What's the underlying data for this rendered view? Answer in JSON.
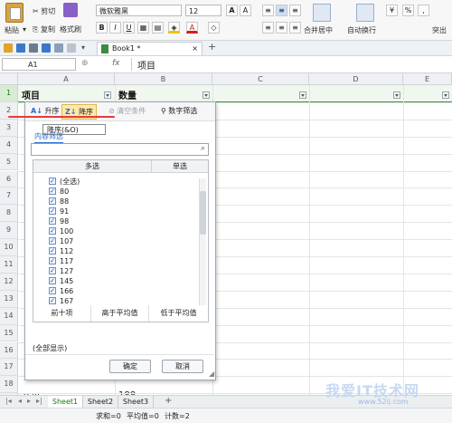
{
  "ribbon": {
    "paste": "粘贴",
    "cut": "剪切",
    "copy": "复制",
    "format_painter": "格式刷",
    "font_name": "微软雅黑",
    "font_size": "12",
    "bold": "B",
    "italic": "I",
    "underline": "U",
    "merge_center": "合并居中",
    "wrap_text": "自动换行",
    "overflow": "突出"
  },
  "quickbar": {
    "book_tab": "Book1 *",
    "new_tab": "+"
  },
  "formula_bar": {
    "name_box": "A1",
    "fx": "fx",
    "content": "项目"
  },
  "grid": {
    "columns": [
      "A",
      "B",
      "C",
      "D",
      "E"
    ],
    "rows": [
      "1",
      "2",
      "3",
      "4",
      "5",
      "6",
      "7",
      "8",
      "9",
      "10",
      "11",
      "12",
      "13",
      "14",
      "15",
      "16",
      "17",
      "18",
      "19"
    ],
    "a1": "项目",
    "b1": "数量",
    "a19": "兰州",
    "b19": "188"
  },
  "filter_popup": {
    "sort_asc": "升序",
    "sort_desc": "降序",
    "tooltip": "降序(&O)",
    "clear": "清空条件",
    "number_filter": "数字筛选",
    "content_filter": "内容筛选",
    "tab_multi": "多选",
    "tab_single": "单选",
    "items": [
      "(全选)",
      "80",
      "88",
      "91",
      "98",
      "100",
      "107",
      "112",
      "117",
      "127",
      "145",
      "166",
      "167"
    ],
    "top10": "前十项",
    "above_avg": "高于平均值",
    "below_avg": "低于平均值",
    "show_all": "(全部显示)",
    "ok": "确定",
    "cancel": "取消"
  },
  "sheets": [
    "Sheet1",
    "Sheet2",
    "Sheet3"
  ],
  "status": {
    "sum": "求和=0",
    "avg": "平均值=0",
    "count": "计数=2"
  },
  "watermark": {
    "main": "我爱IT技术网",
    "url": "www.52ij.com"
  }
}
